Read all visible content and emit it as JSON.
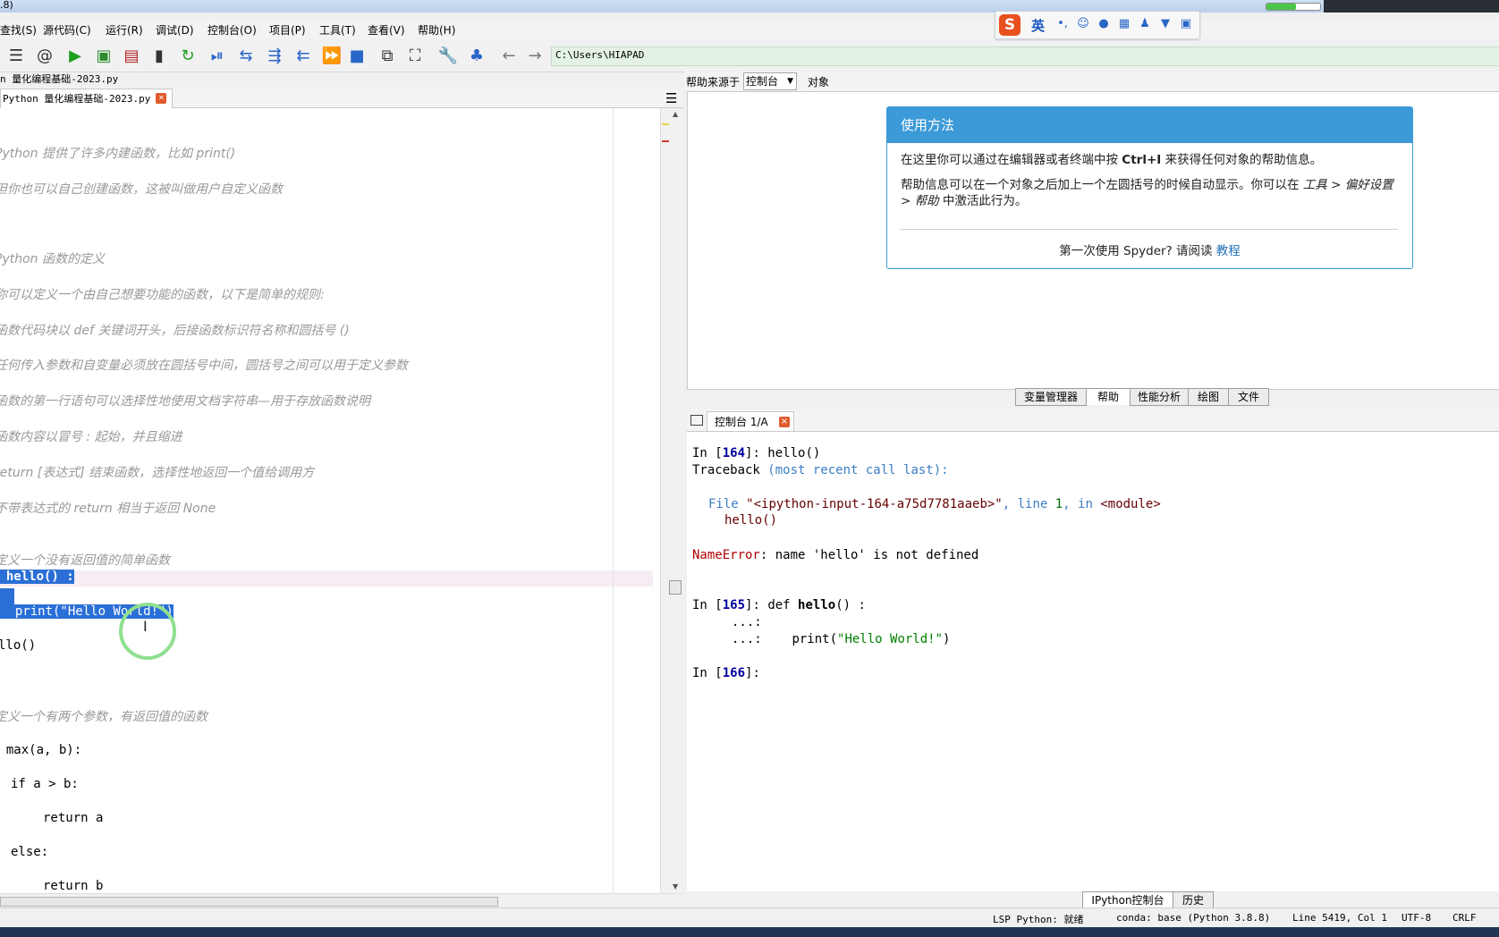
{
  "window": {
    "title_fragment": ".8)"
  },
  "menu": [
    {
      "label": "查找(S)",
      "icon": "menu"
    },
    {
      "label": "源代码(C)"
    },
    {
      "label": "运行(R)"
    },
    {
      "label": "调试(D)"
    },
    {
      "label": "控制台(O)"
    },
    {
      "label": "项目(P)"
    },
    {
      "label": "工具(T)"
    },
    {
      "label": "查看(V)"
    },
    {
      "label": "帮助(H)"
    }
  ],
  "ime": {
    "logo": "S",
    "lang": "英",
    "icons": [
      "punctuation-icon",
      "emoji-icon",
      "microphone-icon",
      "keyboard-icon",
      "user-icon",
      "skin-icon",
      "toolbox-icon"
    ]
  },
  "progress": {
    "fraction": 0.55,
    "color": "#4cc54c"
  },
  "toolbar": {
    "path": "C:\\Users\\HIAPAD",
    "icons": [
      "outline-icon",
      "at-icon",
      "run-icon",
      "run-cell-icon",
      "run-cell-advance-icon",
      "run-selection-icon",
      "rerun-icon",
      "debug-icon",
      "step-icon",
      "step-into-icon",
      "step-return-icon",
      "continue-icon",
      "stop-icon",
      "maximize-pane-icon",
      "fullscreen-icon",
      "wrench-icon",
      "python-icon",
      "back-arrow-icon",
      "forward-arrow-icon"
    ]
  },
  "editor": {
    "file_path": "n 量化编程基础-2023.py",
    "tab_label": "Python 量化编程基础-2023.py",
    "comments": [
      "Python 提供了许多内建函数，比如 print()",
      "但你也可以自己创建函数，这被叫做用户自定义函数",
      "Python 函数的定义",
      "你可以定义一个由自己想要功能的函数，以下是简单的规则:",
      "函数代码块以 def 关键词开头，后接函数标识符名称和圆括号 ()",
      "任何传入参数和自变量必须放在圆括号中间，圆括号之间可以用于定义参数",
      "函数的第一行语句可以选择性地使用文档字符串—用于存放函数说明",
      "函数内容以冒号 : 起始，并且缩进",
      "return [表达式] 结束函数，选择性地返回一个值给调用方",
      "不带表达式的 return 相当于返回 None",
      "定义一个没有返回值的简单函数",
      "定义一个有两个参数，有返回值的函数"
    ],
    "code": {
      "def_hello_prefix": "f ",
      "def_hello": "hello() :",
      "print_hello": "print(\"Hello World!\")",
      "call_hello": "llo()",
      "def_max_prefix": "f ",
      "def_max": "max(a, b):",
      "if_line": "if a > b:",
      "return_a": "return a",
      "else_line": "else:",
      "return_b": "return b"
    }
  },
  "help": {
    "source_label": "帮助来源于",
    "source_value": "控制台",
    "object_label": "对象",
    "usage_title": "使用方法",
    "usage_p1_a": "在这里你可以通过在编辑器或者终端中按 ",
    "usage_p1_key": "Ctrl+I",
    "usage_p1_b": " 来获得任何对象的帮助信息。",
    "usage_p2_a": "帮助信息可以在一个对象之后加上一个左圆括号的时候自动显示。你可以在 ",
    "usage_p2_em1": "工具 > 偏好设置 > 帮助",
    "usage_p2_b": " 中激活此行为。",
    "footer_text": "第一次使用 Spyder? 请阅读 ",
    "footer_link": "教程",
    "tabs": [
      "变量管理器",
      "帮助",
      "性能分析",
      "绘图",
      "文件"
    ],
    "active_tab": "帮助"
  },
  "console": {
    "tab_label": "控制台 1/A",
    "lines": {
      "in164_prompt": "In [",
      "in164_num": "164",
      "in164_rest": "]: hello()",
      "traceback": "Traceback ",
      "traceback_b": "(most recent call last):",
      "file_a": "File ",
      "file_b": "\"<ipython-input-164-a75d7781aaeb>\"",
      "file_c": ", line ",
      "file_d": "1",
      "file_e": ", in ",
      "file_f": "<module>",
      "hello_call": "hello()",
      "err_name": "NameError",
      "err_msg": ": name 'hello' is not defined",
      "in165_num": "165",
      "in165_def": "def ",
      "in165_fn": "hello",
      "in165_rest": "() :",
      "cont1": "...:",
      "cont2": "...:",
      "cont2_code": "print(",
      "cont2_str": "\"Hello World!\"",
      "cont2_end": ")",
      "in166_num": "166",
      "prompt_close": "]:"
    }
  },
  "bottom_tabs": [
    "IPython控制台",
    "历史"
  ],
  "status": {
    "lsp": "LSP Python: 就绪",
    "conda": "conda: base (Python 3.8.8)",
    "position": "Line 5419, Col 1",
    "encoding": "UTF-8",
    "eol": "CRLF"
  }
}
